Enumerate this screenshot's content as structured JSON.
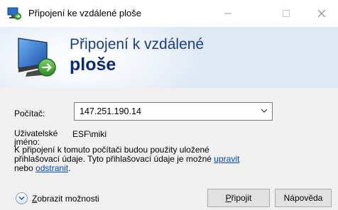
{
  "window": {
    "title": "Připojení ke vzdálené ploše",
    "minimize_icon": "minimize-icon",
    "maximize_icon": "maximize-icon",
    "close_icon": "close-icon"
  },
  "banner": {
    "title_line1": "Připojení k vzdálené",
    "title_line2": "ploše",
    "icon": "remote-desktop-icon"
  },
  "form": {
    "computer_label": "Počítač:",
    "computer_value": "147.251.190.14",
    "user_label_line1": "Uživatelské",
    "user_label_line2": "jméno:",
    "user_value": "ESF\\miki",
    "info_line1": "K připojení k tomuto počítači budou použity uložené",
    "info_line2": "přihlašovací údaje. Tyto přihlašovací údaje je možné",
    "info_link_edit": "upravit",
    "info_line3_pre": "nebo",
    "info_link_delete": "odstranit",
    "info_line3_post": "."
  },
  "footer": {
    "show_options_accel": "Z",
    "show_options_rest": "obrazit možnosti",
    "connect_accel": "P",
    "connect_rest": "řipojit",
    "help_label": "Nápověda"
  },
  "colors": {
    "banner_bg": "#dfe9f4",
    "banner_title": "#1a3c8c",
    "link": "#0047c8"
  }
}
